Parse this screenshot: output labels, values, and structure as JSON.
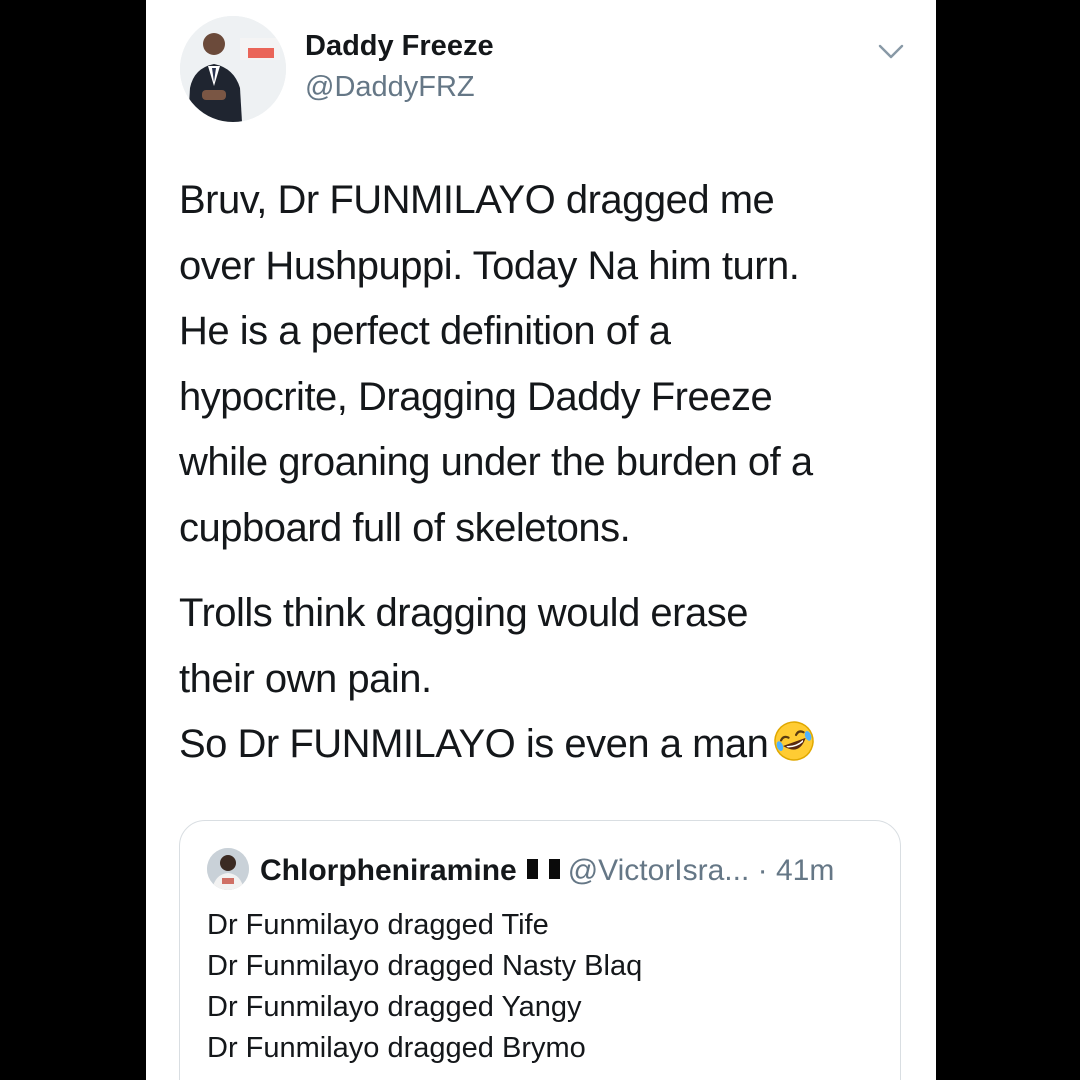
{
  "tweet": {
    "author": {
      "name": "Daddy Freeze",
      "handle": "@DaddyFRZ",
      "avatar_icon": "profile-photo-man-in-suit"
    },
    "menu_icon": "chevron-down-icon",
    "paragraphs": [
      "Bruv, Dr FUNMILAYO dragged me",
      "over Hushpuppi. Today Na him turn.",
      "He is a perfect definition of a",
      "hypocrite, Dragging Daddy Freeze",
      "while groaning under the burden of a",
      "cupboard full of skeletons."
    ],
    "paragraphs2": [
      "Trolls think dragging would erase",
      "their own pain."
    ],
    "last_line": "So Dr FUNMILAYO is even a man",
    "last_line_emoji": "rolling-on-the-floor-laughing-emoji"
  },
  "quoted": {
    "name": "Chlorpheniramine",
    "flag_icon": "nigeria-flag-icon",
    "handle": "@VictorIsra...",
    "time": "· 41m",
    "lines": [
      "Dr Funmilayo dragged Tife",
      "Dr Funmilayo dragged Nasty Blaq",
      "Dr Funmilayo dragged Yangy",
      "Dr Funmilayo dragged Brymo"
    ]
  },
  "colors": {
    "text": "#14171a",
    "secondary": "#657786",
    "border": "#d9dee2",
    "nigeria_green": "#008751"
  }
}
